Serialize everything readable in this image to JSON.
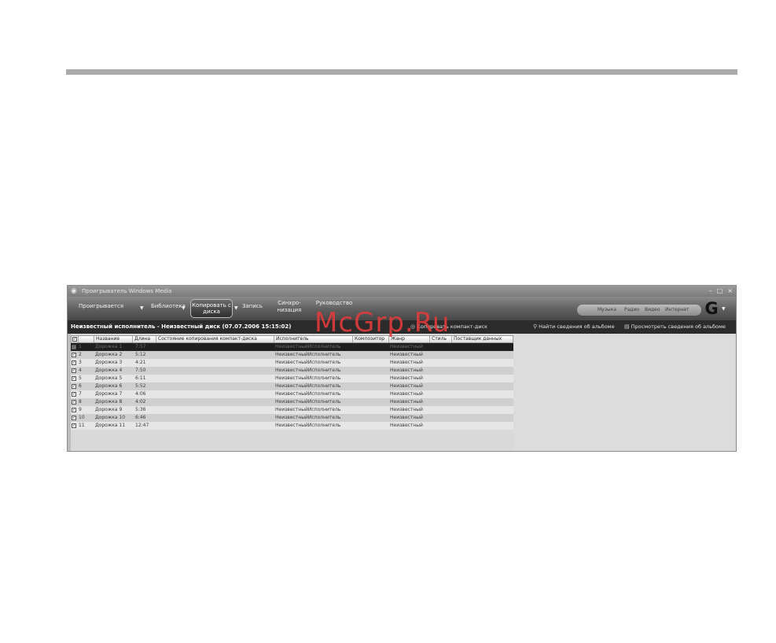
{
  "window": {
    "title": "Проигрыватель Windows Media",
    "controls": [
      "–",
      "□",
      "×"
    ]
  },
  "nav": {
    "tabs": [
      {
        "label": "Проигрывается"
      },
      {
        "label": "Библиотека"
      },
      {
        "label": "Копировать с диска",
        "active": true
      },
      {
        "label": "Запись"
      },
      {
        "label": "Синхро-низация"
      },
      {
        "label": "Руководство"
      }
    ],
    "right_items": [
      "Музыка",
      "Радио",
      "Видео",
      "Интернет"
    ]
  },
  "toolbar": {
    "album_title": "Неизвестный исполнитель - Неизвестный диск (07.07.2006 15:15:02)",
    "rip_label": "Копировать компакт-диск",
    "find_album_label": "Найти сведения об альбоме",
    "view_album_label": "Просмотреть сведения об альбоме"
  },
  "table": {
    "columns": [
      "Название",
      "Длина",
      "Состояние копирования компакт-диска",
      "Исполнитель",
      "Композитор",
      "Жанр",
      "Стиль",
      "Поставщик данных"
    ],
    "rows": [
      {
        "num": "1",
        "title": "Дорожка 1",
        "length": "7:57",
        "artist": "НеизвестныйИсполнитель",
        "genre": "Неизвестный",
        "selected": true
      },
      {
        "num": "2",
        "title": "Дорожка 2",
        "length": "5:12",
        "artist": "НеизвестныйИсполнитель",
        "genre": "Неизвестный"
      },
      {
        "num": "3",
        "title": "Дорожка 3",
        "length": "4:21",
        "artist": "НеизвестныйИсполнитель",
        "genre": "Неизвестный"
      },
      {
        "num": "4",
        "title": "Дорожка 4",
        "length": "7:50",
        "artist": "НеизвестныйИсполнитель",
        "genre": "Неизвестный"
      },
      {
        "num": "5",
        "title": "Дорожка 5",
        "length": "6:11",
        "artist": "НеизвестныйИсполнитель",
        "genre": "Неизвестный"
      },
      {
        "num": "6",
        "title": "Дорожка 6",
        "length": "5:52",
        "artist": "НеизвестныйИсполнитель",
        "genre": "Неизвестный"
      },
      {
        "num": "7",
        "title": "Дорожка 7",
        "length": "4:06",
        "artist": "НеизвестныйИсполнитель",
        "genre": "Неизвестный"
      },
      {
        "num": "8",
        "title": "Дорожка 8",
        "length": "4:02",
        "artist": "НеизвестныйИсполнитель",
        "genre": "Неизвестный"
      },
      {
        "num": "9",
        "title": "Дорожка 9",
        "length": "5:36",
        "artist": "НеизвестныйИсполнитель",
        "genre": "Неизвестный"
      },
      {
        "num": "10",
        "title": "Дорожка 10",
        "length": "6:46",
        "artist": "НеизвестныйИсполнитель",
        "genre": "Неизвестный"
      },
      {
        "num": "11",
        "title": "Дорожка 11",
        "length": "12:47",
        "artist": "НеизвестныйИсполнитель",
        "genre": "Неизвестный"
      }
    ]
  },
  "watermark": "McGrp.Ru",
  "colors": {
    "selected_row": "#1f1f1f",
    "navbar": "#5e5e5e",
    "watermark": "#e23b3b"
  }
}
